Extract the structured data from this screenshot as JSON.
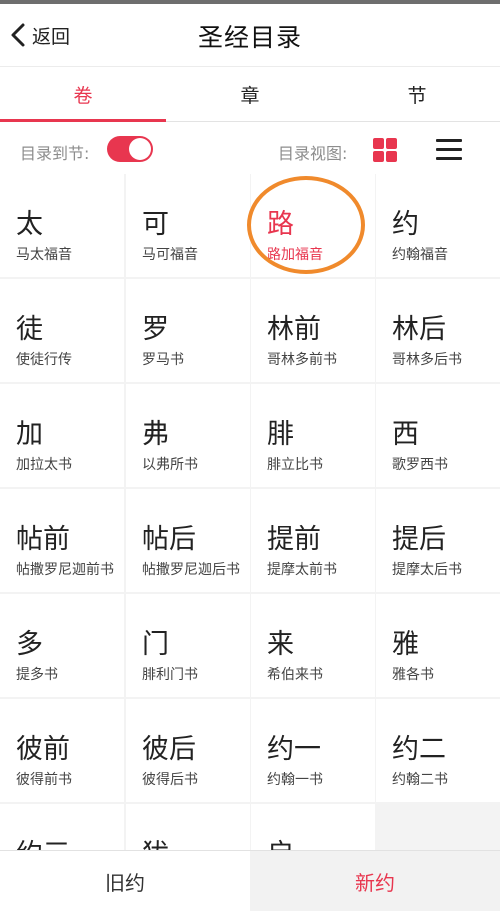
{
  "header": {
    "back_label": "返回",
    "title": "圣经目录"
  },
  "tabs": [
    {
      "label": "卷",
      "active": true
    },
    {
      "label": "章",
      "active": false
    },
    {
      "label": "节",
      "active": false
    }
  ],
  "options": {
    "toc_to_verse_label": "目录到节:",
    "toc_to_verse_on": true,
    "toc_view_label": "目录视图:",
    "view_mode": "grid"
  },
  "books": [
    {
      "abbr": "太",
      "name": "马太福音"
    },
    {
      "abbr": "可",
      "name": "马可福音"
    },
    {
      "abbr": "路",
      "name": "路加福音",
      "selected": true
    },
    {
      "abbr": "约",
      "name": "约翰福音"
    },
    {
      "abbr": "徒",
      "name": "使徒行传"
    },
    {
      "abbr": "罗",
      "name": "罗马书"
    },
    {
      "abbr": "林前",
      "name": "哥林多前书"
    },
    {
      "abbr": "林后",
      "name": "哥林多后书"
    },
    {
      "abbr": "加",
      "name": "加拉太书"
    },
    {
      "abbr": "弗",
      "name": "以弗所书"
    },
    {
      "abbr": "腓",
      "name": "腓立比书"
    },
    {
      "abbr": "西",
      "name": "歌罗西书"
    },
    {
      "abbr": "帖前",
      "name": "帖撒罗尼迦前书"
    },
    {
      "abbr": "帖后",
      "name": "帖撒罗尼迦后书"
    },
    {
      "abbr": "提前",
      "name": "提摩太前书"
    },
    {
      "abbr": "提后",
      "name": "提摩太后书"
    },
    {
      "abbr": "多",
      "name": "提多书"
    },
    {
      "abbr": "门",
      "name": "腓利门书"
    },
    {
      "abbr": "来",
      "name": "希伯来书"
    },
    {
      "abbr": "雅",
      "name": "雅各书"
    },
    {
      "abbr": "彼前",
      "name": "彼得前书"
    },
    {
      "abbr": "彼后",
      "name": "彼得后书"
    },
    {
      "abbr": "约一",
      "name": "约翰一书"
    },
    {
      "abbr": "约二",
      "name": "约翰二书"
    },
    {
      "abbr": "约三",
      "name": ""
    },
    {
      "abbr": "犹",
      "name": ""
    },
    {
      "abbr": "启",
      "name": ""
    }
  ],
  "bottom_tabs": {
    "old": "旧约",
    "new": "新约",
    "active": "new"
  },
  "colors": {
    "accent": "#e8364f",
    "annotation_circle": "#f08a2c",
    "grid_gap": "#f3f3f3"
  },
  "icons": [
    "chevron-left-icon",
    "toggle-switch",
    "grid-view-icon",
    "list-view-icon"
  ]
}
